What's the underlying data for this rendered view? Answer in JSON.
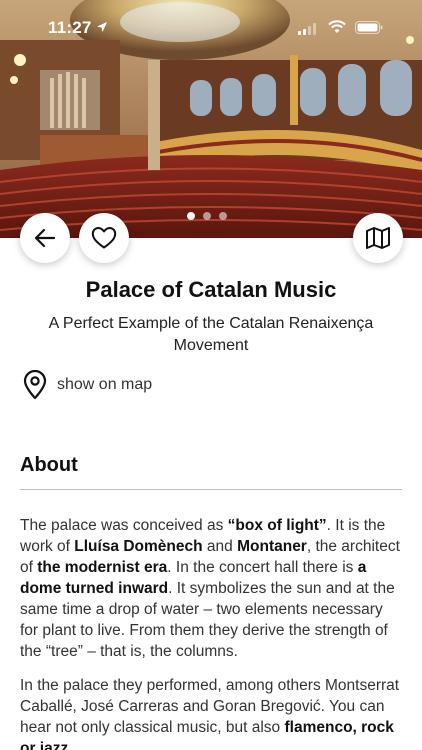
{
  "status_bar": {
    "time": "11:27"
  },
  "hero": {
    "slide_count": 3,
    "active_slide": 1
  },
  "place": {
    "title": "Palace of Catalan Music",
    "subtitle": "A Perfect Example of the Catalan Renaixença Movement",
    "show_on_map_label": "show on map"
  },
  "about": {
    "heading": "About",
    "p1": {
      "s1": "The palace was conceived as ",
      "b1": "“box of light”",
      "s2": ". It is the work of ",
      "b2": "Lluísa Domènech",
      "s3": " and ",
      "b3": "Montaner",
      "s4": ", the architect of ",
      "b4": "the modernist era",
      "s5": ". In the concert hall there is ",
      "b5": "a dome turned inward",
      "s6": ". It symbolizes the sun and at the same time a drop of water – two elements necessary for plant to live. From them they derive the strength of the “tree” – that is, the columns."
    },
    "p2": {
      "s1": "In the palace they performed, among others Montserrat Caballé, José Carreras and Goran Bregović. You can hear not only classical music, but also ",
      "b1": "flamenco, rock or jazz",
      "s2": "."
    }
  },
  "colors": {
    "accent_text": "#111111",
    "hero_red": "#9a2a1c",
    "hero_gold": "#d9a54a"
  }
}
